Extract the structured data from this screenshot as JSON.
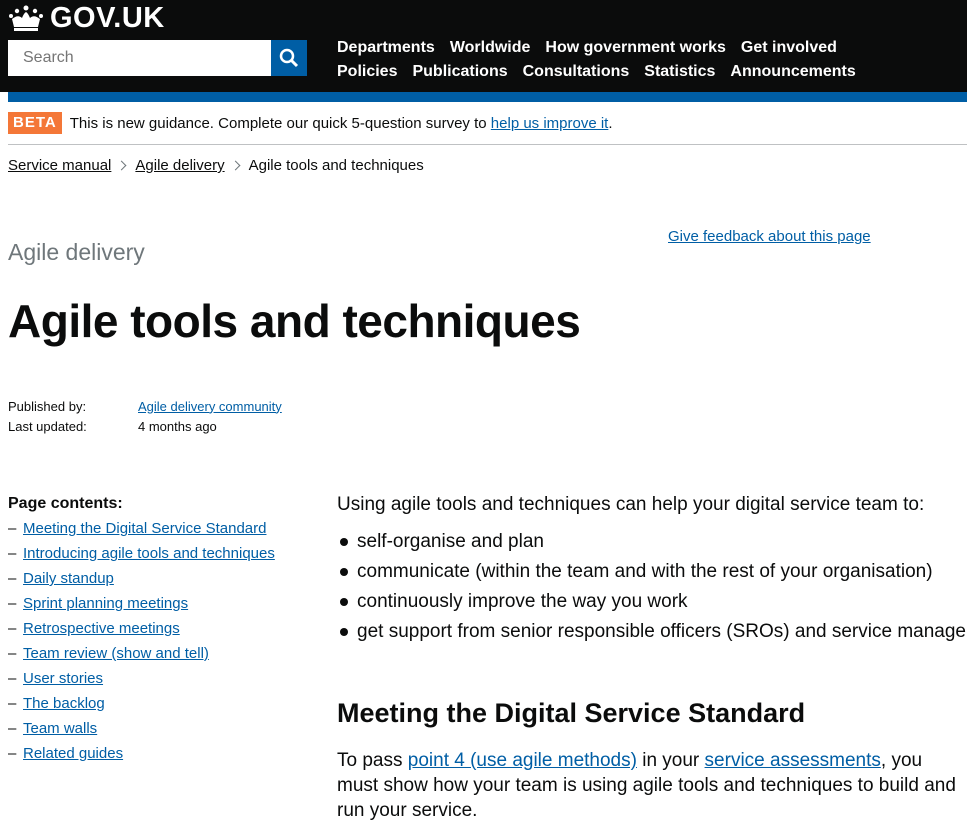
{
  "header": {
    "logo_text": "GOV.UK",
    "search_placeholder": "Search",
    "nav_row1": [
      "Departments",
      "Worldwide",
      "How government works",
      "Get involved"
    ],
    "nav_row2": [
      "Policies",
      "Publications",
      "Consultations",
      "Statistics",
      "Announcements"
    ]
  },
  "beta": {
    "tag": "BETA",
    "text": "This is new guidance. Complete our quick 5-question survey to ",
    "link": "help us improve it",
    "end": "."
  },
  "breadcrumb": [
    "Service manual",
    "Agile delivery",
    "Agile tools and techniques"
  ],
  "feedback_link": "Give feedback about this page",
  "section_label": "Agile delivery",
  "title": "Agile tools and techniques",
  "meta": {
    "published_label": "Published by:",
    "published_value": "Agile delivery community",
    "updated_label": "Last updated:",
    "updated_value": "4 months ago"
  },
  "contents": {
    "heading": "Page contents:",
    "items": [
      "Meeting the Digital Service Standard",
      "Introducing agile tools and techniques",
      "Daily standup",
      "Sprint planning meetings",
      "Retrospective meetings",
      "Team review (show and tell)",
      "User stories",
      "The backlog",
      "Team walls",
      "Related guides"
    ]
  },
  "body": {
    "intro": "Using agile tools and techniques can help your digital service team to:",
    "bullets": [
      "self-organise and plan",
      "communicate (within the team and with the rest of your organisation)",
      "continuously improve the way you work",
      "get support from senior responsible officers (SROs) and service managers"
    ],
    "h2": "Meeting the Digital Service Standard",
    "p2_a": "To pass ",
    "p2_link1": "point 4 (use agile methods)",
    "p2_b": " in your ",
    "p2_link2": "service assessments",
    "p2_c": ", you must show how your team is using agile tools and techniques to build and run your service."
  },
  "colors": {
    "header_bg": "#0b0c0c",
    "brand_blue": "#005ea5",
    "beta_orange": "#f47738",
    "link": "#005ea5"
  },
  "icons": {
    "logo": "crown-icon",
    "search": "search-icon",
    "breadcrumb_separator": "chevron-right-icon"
  }
}
